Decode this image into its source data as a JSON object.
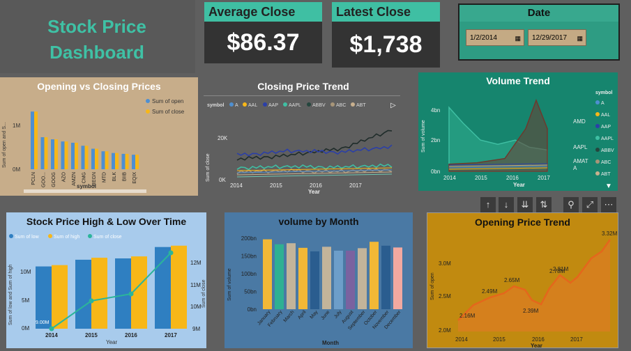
{
  "title": {
    "line1": "Stock Price",
    "line2": "Dashboard"
  },
  "kpis": {
    "avg_label": "Average Close",
    "avg_value": "$86.37",
    "latest_label": "Latest Close",
    "latest_value": "$1,738"
  },
  "date_filter": {
    "label": "Date",
    "start": "1/2/2014",
    "end": "12/29/2017"
  },
  "colors": {
    "teal": "#3fbfa3",
    "dark_green": "#16856e",
    "tan": "#c7ad8a",
    "orange": "#e58a1e",
    "blue": "#2f7fc1",
    "yellow": "#f7b718"
  },
  "open_close": {
    "title": "Opening vs Closing Prices",
    "legend_open": "Sum of open",
    "legend_close": "Sum of close",
    "ylabel": "Sum of open and S...",
    "xlabel": "symbol",
    "y_ticks": [
      "1M",
      "0M"
    ],
    "chart_data": {
      "type": "bar",
      "categories": [
        "PCLN",
        "GOO...",
        "GOOG",
        "AZO",
        "AMZN",
        "CMG",
        "REGN",
        "MTD",
        "BLK",
        "BIIB",
        "EQIX"
      ],
      "series": [
        {
          "name": "Sum of open",
          "values": [
            1.35,
            0.75,
            0.7,
            0.65,
            0.62,
            0.55,
            0.48,
            0.42,
            0.38,
            0.36,
            0.34
          ]
        },
        {
          "name": "Sum of close",
          "values": [
            1.35,
            0.75,
            0.7,
            0.65,
            0.62,
            0.55,
            0.48,
            0.42,
            0.38,
            0.36,
            0.34
          ]
        }
      ],
      "ylim": [
        0,
        1.5
      ]
    }
  },
  "closing_trend": {
    "title": "Closing Price Trend",
    "legend_label": "symbol",
    "legend": [
      "A",
      "AAL",
      "AAP",
      "AAPL",
      "ABBV",
      "ABC",
      "ABT"
    ],
    "legend_colors": [
      "#4e8fd1",
      "#f7b718",
      "#2b3fa8",
      "#3fbfa3",
      "#25463e",
      "#a89578",
      "#c8b08e"
    ],
    "ylabel": "Sum of close",
    "xlabel": "Year",
    "y_ticks": [
      "20K",
      "0K"
    ],
    "x_ticks": [
      "2014",
      "2015",
      "2016",
      "2017"
    ],
    "chart_data": {
      "type": "line",
      "x": [
        "2014",
        "2015",
        "2016",
        "2017"
      ],
      "series": [
        {
          "name": "AAPL",
          "values": [
            10000,
            12000,
            15000,
            24000
          ]
        },
        {
          "name": "AAP",
          "values": [
            12000,
            14000,
            13500,
            16000
          ]
        },
        {
          "name": "ABBV",
          "values": [
            6000,
            6500,
            6300,
            7000
          ]
        },
        {
          "name": "ABC",
          "values": [
            4000,
            4500,
            4200,
            5000
          ]
        }
      ],
      "ylim": [
        0,
        26000
      ]
    }
  },
  "volume_trend": {
    "title": "Volume Trend",
    "ylabel": "Sum of volume",
    "xlabel": "Year",
    "y_ticks": [
      "4bn",
      "2bn",
      "0bn"
    ],
    "x_ticks": [
      "2014",
      "2015",
      "2016",
      "2017"
    ],
    "legend_label": "symbol",
    "legend": [
      "A",
      "AAL",
      "AAP",
      "AAPL",
      "ABBV",
      "ABC",
      "ABT"
    ],
    "legend_colors": [
      "#4e8fd1",
      "#f7b718",
      "#2b3fa8",
      "#3fbfa3",
      "#25463e",
      "#a89578",
      "#c8b08e"
    ],
    "annotations": [
      "AMD",
      "AAPL",
      "AMAT",
      "A"
    ],
    "chart_data": {
      "type": "area",
      "x": [
        "2014",
        "2015",
        "2016",
        "2017"
      ],
      "series": [
        {
          "name": "AAPL",
          "values": [
            4.5,
            2.2,
            1.8,
            1.5
          ]
        },
        {
          "name": "AMD",
          "values": [
            0.5,
            0.6,
            1.0,
            5.0
          ]
        }
      ],
      "ylim": [
        0,
        5
      ]
    }
  },
  "toolbar": {
    "up": "↑",
    "down": "↓",
    "drill": "⇊",
    "expand": "⇅",
    "filter": "⚲",
    "focus": "⤢",
    "more": "⋯"
  },
  "high_low": {
    "title": "Stock Price High & Low Over Time",
    "legend": [
      "Sum of low",
      "Sum of high",
      "Sum of close"
    ],
    "ylabel": "Sum of low and Sum of high",
    "y2label": "Sum of close",
    "xlabel": "Year",
    "y_ticks": [
      "10M",
      "5M",
      "0M"
    ],
    "y2_ticks": [
      "12M",
      "11M",
      "10M",
      "9M"
    ],
    "point_label": "9.00M",
    "chart_data": {
      "type": "bar",
      "categories": [
        "2014",
        "2015",
        "2016",
        "2017"
      ],
      "series": [
        {
          "name": "Sum of low",
          "values": [
            9.3,
            10.3,
            10.5,
            12.2
          ]
        },
        {
          "name": "Sum of high",
          "values": [
            9.5,
            10.6,
            10.8,
            12.4
          ]
        },
        {
          "name": "Sum of close",
          "values": [
            9.4,
            10.45,
            10.7,
            12.3
          ]
        }
      ],
      "ylim": [
        0,
        13
      ]
    }
  },
  "volume_month": {
    "title": "volume by Month",
    "ylabel": "Sum of volume",
    "xlabel": "Month",
    "y_ticks": [
      "200bn",
      "150bn",
      "100bn",
      "50bn",
      "0bn"
    ],
    "chart_data": {
      "type": "bar",
      "categories": [
        "January",
        "February",
        "March",
        "April",
        "May",
        "June",
        "July",
        "August",
        "September",
        "October",
        "November",
        "December"
      ],
      "values": [
        197,
        183,
        186,
        173,
        163,
        176,
        165,
        165,
        172,
        190,
        179,
        174
      ],
      "colors": [
        "#f2b836",
        "#2fb092",
        "#c3b49a",
        "#f2b836",
        "#2a5d8f",
        "#c3b49a",
        "#6d9ec9",
        "#7a62a0",
        "#c3b49a",
        "#f2b836",
        "#2a5d8f",
        "#f2a9a0"
      ],
      "ylim": [
        0,
        210
      ]
    }
  },
  "opening_trend": {
    "title": "Opening Price Trend",
    "ylabel": "Sum of open",
    "xlabel": "Year",
    "y_ticks": [
      "3.0M",
      "2.5M",
      "2.0M"
    ],
    "x_ticks": [
      "2014",
      "2015",
      "2016",
      "2017"
    ],
    "chart_data": {
      "type": "area",
      "x": [
        "2014",
        "2014.5",
        "2015",
        "2015.5",
        "2016",
        "2016.25",
        "2016.5",
        "2017",
        "2017.5"
      ],
      "labels": [
        "2.16M",
        "2.49M",
        "2.65M",
        "2.39M",
        "2.81M",
        "2.78M",
        "3.32M"
      ],
      "values": [
        2.16,
        2.49,
        2.65,
        2.39,
        2.81,
        2.78,
        3.32
      ],
      "ylim": [
        2.0,
        3.4
      ]
    }
  }
}
